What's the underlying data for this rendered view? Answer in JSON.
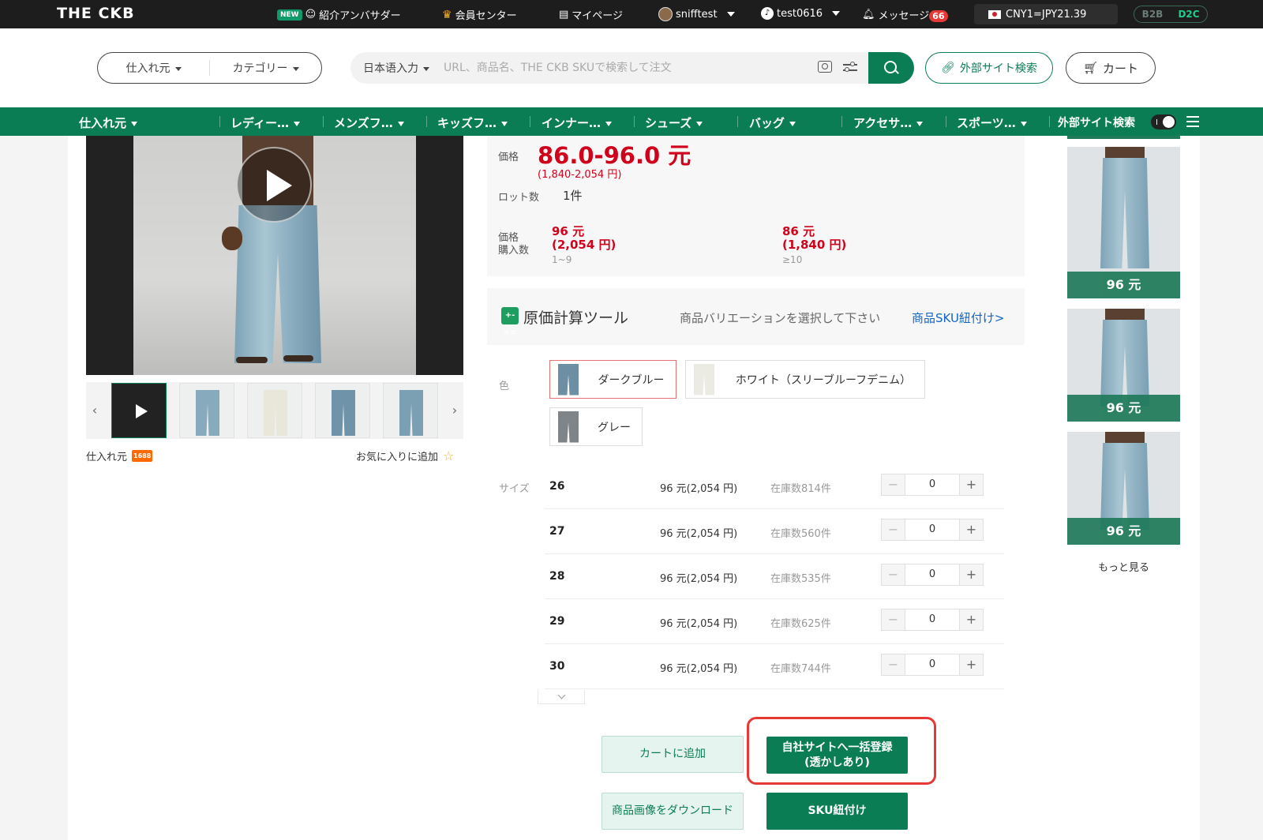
{
  "topbar": {
    "logo": "THE CKB",
    "new_badge": "NEW",
    "ambassador": "紹介アンバサダー",
    "member_center": "会員センター",
    "mypage": "マイページ",
    "user1": "snifftest",
    "user2": "test0616",
    "messages": "メッセージ",
    "message_count": "66",
    "rate": "CNY1=JPY21.39",
    "mode_b2b": "B2B",
    "mode_d2c": "D2C"
  },
  "header": {
    "source_select": "仕入れ元",
    "category_select": "カテゴリー",
    "lang_select": "日本语入力",
    "search_placeholder": "URL、商品名、THE CKB SKUで検索して注文",
    "external_search": "外部サイト検索",
    "cart": "カート"
  },
  "nav": {
    "items": [
      "仕入れ元",
      "レディー…",
      "メンズフ…",
      "キッズフ…",
      "インナー…",
      "シューズ",
      "バッグ",
      "アクセサ…",
      "スポーツ…"
    ],
    "external_toggle_label": "外部サイト検索"
  },
  "gallery": {
    "source_label": "仕入れ元",
    "source_badge": "1688",
    "favorite": "お気に入りに追加"
  },
  "price": {
    "label": "価格",
    "range": "86.0-96.0 元",
    "range_jpy": "(1,840-2,054 円)",
    "lot_label": "ロット数",
    "lot_value": "1件",
    "tier_label_1": "価格",
    "tier_label_2": "購入数",
    "tiers": [
      {
        "cny": "96 元",
        "jpy": "(2,054 円)",
        "qty": "1~9"
      },
      {
        "cny": "86 元",
        "jpy": "(1,840 円)",
        "qty": "≥10"
      }
    ]
  },
  "calc": {
    "icon": "+-×=",
    "title": "原価計算ツール",
    "hint": "商品バリエーションを選択して下さい",
    "link": "商品SKU紐付け>"
  },
  "variants": {
    "color_label": "色",
    "colors": [
      {
        "name": "ダークブルー",
        "swatch": "#6d8fa3",
        "selected": true
      },
      {
        "name": "ホワイト（スリーブルーフデニム）",
        "swatch": "#ecebe3",
        "selected": false
      },
      {
        "name": "グレー",
        "swatch": "#7e8488",
        "selected": false
      }
    ],
    "size_label": "サイズ",
    "sizes": [
      {
        "size": "26",
        "price": "96 元(2,054 円)",
        "stock": "在庫数814件",
        "qty": "0"
      },
      {
        "size": "27",
        "price": "96 元(2,054 円)",
        "stock": "在庫数560件",
        "qty": "0"
      },
      {
        "size": "28",
        "price": "96 元(2,054 円)",
        "stock": "在庫数535件",
        "qty": "0"
      },
      {
        "size": "29",
        "price": "96 元(2,054 円)",
        "stock": "在庫数625件",
        "qty": "0"
      },
      {
        "size": "30",
        "price": "96 元(2,054 円)",
        "stock": "在庫数744件",
        "qty": "0"
      }
    ],
    "stepper_minus": "−",
    "stepper_plus": "+"
  },
  "actions": {
    "add_to_cart": "カートに追加",
    "bulk_register_1": "自社サイトへ一括登録",
    "bulk_register_2": "(透かしあり)",
    "download_images": "商品画像をダウンロード",
    "sku_link": "SKU紐付け"
  },
  "recommendations": {
    "items": [
      {
        "price": "96 元"
      },
      {
        "price": "96 元"
      },
      {
        "price": "96 元"
      }
    ],
    "more": "もっと見る"
  },
  "colors": {
    "brand_green": "#0b7d54",
    "price_red": "#d0021b",
    "highlight_red": "#e53935"
  }
}
